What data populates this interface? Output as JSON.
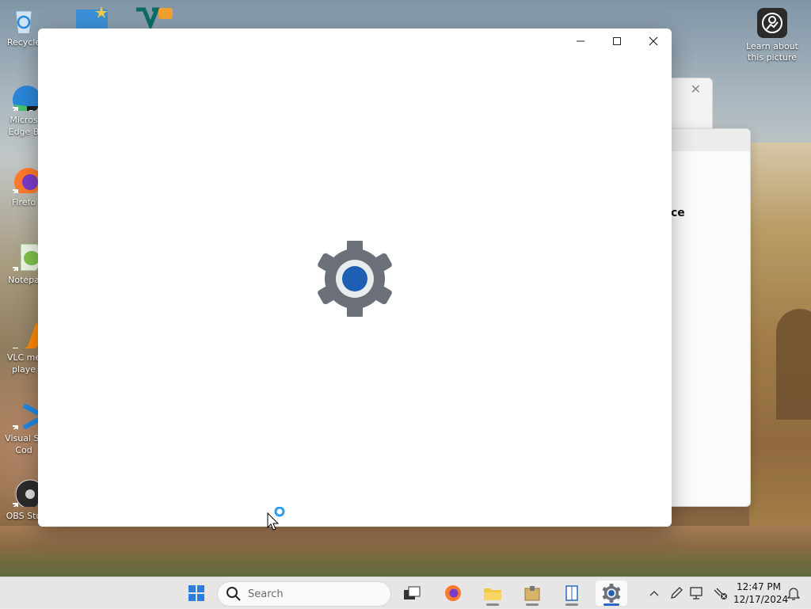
{
  "desktop": {
    "icons": [
      {
        "label": "Recycle",
        "icon": "recycle-bin-icon"
      },
      {
        "label": "Micros\nEdge B",
        "icon": "edge-beta-icon"
      },
      {
        "label": "Firefo",
        "icon": "firefox-icon"
      },
      {
        "label": "Notepa",
        "icon": "notepad-plus-plus-icon"
      },
      {
        "label": "VLC me\nplaye",
        "icon": "vlc-icon"
      },
      {
        "label": "Visual St\nCod",
        "icon": "vscode-icon"
      },
      {
        "label": "OBS Stu",
        "icon": "obs-icon"
      }
    ],
    "learn_about": {
      "label": "Learn about\nthis picture",
      "icon": "camera-icon"
    }
  },
  "background_window": {
    "text_fragment": "ce"
  },
  "main_window": {
    "app_icon": "settings-gear-icon",
    "controls": {
      "minimize": "minimize-icon",
      "maximize": "maximize-icon",
      "close": "close-icon"
    }
  },
  "taskbar": {
    "start_icon": "windows-start-icon",
    "search_placeholder": "Search",
    "apps": [
      {
        "name": "task-view",
        "icon": "task-view-icon",
        "active": false
      },
      {
        "name": "firefox",
        "icon": "firefox-icon",
        "active": false
      },
      {
        "name": "file-explorer",
        "icon": "folder-icon",
        "active": false
      },
      {
        "name": "archive-app",
        "icon": "archive-icon",
        "active": false
      },
      {
        "name": "reader-app",
        "icon": "book-icon",
        "active": false
      },
      {
        "name": "settings",
        "icon": "settings-gear-icon",
        "active": true
      }
    ],
    "tray": [
      "chevron-up-icon",
      "pen-icon",
      "monitor-icon",
      "network-off-icon",
      "bell-icon"
    ],
    "clock": {
      "time": "12:47 PM",
      "date": "12/17/2024"
    }
  },
  "colors": {
    "accent": "#2c66c8",
    "gear_grey": "#6b7079",
    "gear_blue": "#1e5fb4"
  }
}
